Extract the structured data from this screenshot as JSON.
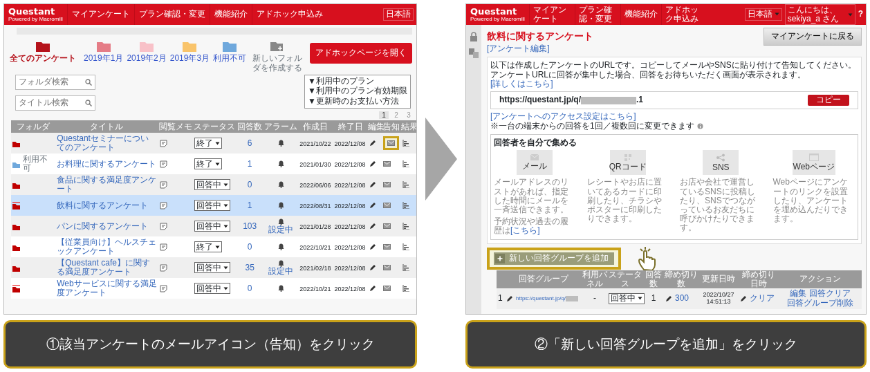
{
  "step1": {
    "nav": {
      "logo": "Questant",
      "logo_sub": "Powered by Macromill",
      "items": [
        "マイアンケート",
        "プラン確認・変更",
        "機能紹介",
        "アドホック申込み"
      ],
      "language": "日本語"
    },
    "folders": [
      {
        "label": "全てのアンケート",
        "color": "#b5121b",
        "selected": true
      },
      {
        "label": "2019年1月",
        "color": "#e57c86",
        "selected": false
      },
      {
        "label": "2019年2月",
        "color": "#f8c1c8",
        "selected": false
      },
      {
        "label": "2019年3月",
        "color": "#f9c46b",
        "selected": false
      },
      {
        "label": "利用不可",
        "color": "#6fa8dc",
        "selected": false
      }
    ],
    "new_folder": "新しいフォルダを作成する",
    "adhoc_button": "アドホックページを開く",
    "folder_search": {
      "placeholder": "フォルダ検索"
    },
    "title_search": {
      "placeholder": "タイトル検索"
    },
    "info_links": [
      "▼利用中のプラン",
      "▼利用中のプラン有効期限",
      "▼更新時のお支払い方法"
    ],
    "pages": [
      {
        "label": "1",
        "selected": true
      },
      {
        "label": "2",
        "selected": false
      },
      {
        "label": "3",
        "selected": false
      }
    ],
    "columns": [
      "フォルダ",
      "タイトル",
      "閲覧メモ",
      "ステータス",
      "回答数",
      "アラーム",
      "作成日",
      "終了日",
      "編集",
      "告知",
      "結果"
    ],
    "rows": [
      {
        "color": "#c00000",
        "title": "Questantセミナーについてのアンケート",
        "status": "終了",
        "responses": "6",
        "alarm_set": false,
        "created": "2021/10/22",
        "ends": "2022/12/08",
        "selected": false,
        "highlighted": true,
        "marked": false
      },
      {
        "color": "#6fa8dc",
        "folder_label": "利用不可",
        "title": "お料理に関するアンケート",
        "status": "終了",
        "responses": "1",
        "alarm_set": false,
        "created": "2021/01/30",
        "ends": "2022/12/08",
        "selected": false,
        "highlighted": false,
        "marked": false
      },
      {
        "color": "#c00000",
        "title": "食品に関する満足度アンケート",
        "status": "回答中",
        "responses": "0",
        "alarm_set": false,
        "created": "2022/06/06",
        "ends": "2022/12/08",
        "selected": false,
        "highlighted": false,
        "marked": false
      },
      {
        "color": "#c00000",
        "title": "飲料に関するアンケート",
        "status": "回答中",
        "responses": "1",
        "alarm_set": false,
        "created": "2022/08/31",
        "ends": "2022/12/08",
        "selected": true,
        "highlighted": false,
        "marked": true
      },
      {
        "color": "#c00000",
        "title": "パンに関するアンケート",
        "status": "回答中",
        "responses": "103",
        "alarm_set": true,
        "alarm_label": "設定中",
        "created": "2021/01/28",
        "ends": "2022/12/08",
        "selected": false,
        "highlighted": false,
        "marked": false
      },
      {
        "color": "#c00000",
        "title": "【従業員向け】ヘルスチェックアンケート",
        "status": "終了",
        "responses": "0",
        "alarm_set": false,
        "created": "2022/10/21",
        "ends": "2022/12/08",
        "selected": false,
        "highlighted": false,
        "marked": false
      },
      {
        "color": "#c00000",
        "title": "【Questant cafe】に関する満足度アンケート",
        "status": "回答中",
        "responses": "35",
        "alarm_set": true,
        "alarm_label": "設定中",
        "created": "2021/02/18",
        "ends": "2022/12/08",
        "selected": false,
        "highlighted": false,
        "marked": false
      },
      {
        "color": "#c00000",
        "title": "Webサービスに関する満足度アンケート",
        "status": "回答中",
        "responses": "0",
        "alarm_set": false,
        "created": "2022/10/21",
        "ends": "2022/12/08",
        "selected": false,
        "highlighted": false,
        "marked": true
      }
    ],
    "caption": "①該当アンケートのメールアイコン（告知）をクリック"
  },
  "step2": {
    "nav": {
      "logo": "Questant",
      "logo_sub": "Powered by Macromill",
      "items": [
        "マイアンケート",
        "プラン確認・変更",
        "機能紹介",
        "アドホック申込み"
      ],
      "language": "日本語",
      "greeting": "こんにちは、sekiya_a さん",
      "help": "?"
    },
    "title": "飲料に関するアンケート",
    "edit_link": "[アンケート編集]",
    "back_button": "マイアンケートに戻る",
    "intro": "以下は作成したアンケートのURLです。コピーしてメールやSNSに貼り付けて告知してください。",
    "intro2": "アンケートURLに回答が集中した場合、回答をお待ちいただく画面が表示されます。",
    "details_link": "[詳しくはこちら]",
    "url_prefix": "https://questant.jp/q/",
    "url_suffix": ".1",
    "copy_button": "コピー",
    "access_link": "[アンケートへのアクセス設定はこちら]",
    "access_note": "※一台の端末からの回答を1回／複数回に変更できます",
    "collect_title": "回答者を自分で集める",
    "channels": [
      {
        "kind": "mail",
        "label": "メール",
        "text": "メールアドレスのリストがあれば、指定した時間にメールを一斉送信できます。",
        "note": "予約状況や過去の履歴は",
        "link": "[こちら]"
      },
      {
        "kind": "qr",
        "label": "QRコード",
        "text": "レシートやお店に置いてあるカードに印刷したり、チラシやポスターに印刷したりできます。"
      },
      {
        "kind": "sns",
        "label": "SNS",
        "text": "お店や会社で運営しているSNSに投稿したり、SNSでつながっているお友だちに呼びかけたりできます。"
      },
      {
        "kind": "web",
        "label": "Webページ",
        "text": "Webページにアンケートのリンクを設置したり、アンケートを埋め込んだりできます。"
      }
    ],
    "add_group_button": "新しい回答グループを追加",
    "columns": [
      "回答グループ",
      "利用パネル",
      "ステータス",
      "回答数",
      "締め切り数",
      "更新日時",
      "締め切り日時",
      "アクション"
    ],
    "group_rows": [
      {
        "number": "1",
        "url": "https://questant.jp/q/",
        "panel": "-",
        "status": "回答中",
        "responses": "1",
        "limit": "300",
        "updated": "2022/10/27 14:51:13",
        "clear": "クリア",
        "actions": [
          "編集 回答クリア",
          "回答グループ削除"
        ]
      }
    ],
    "caption": "②「新しい回答グループを追加」をクリック"
  }
}
